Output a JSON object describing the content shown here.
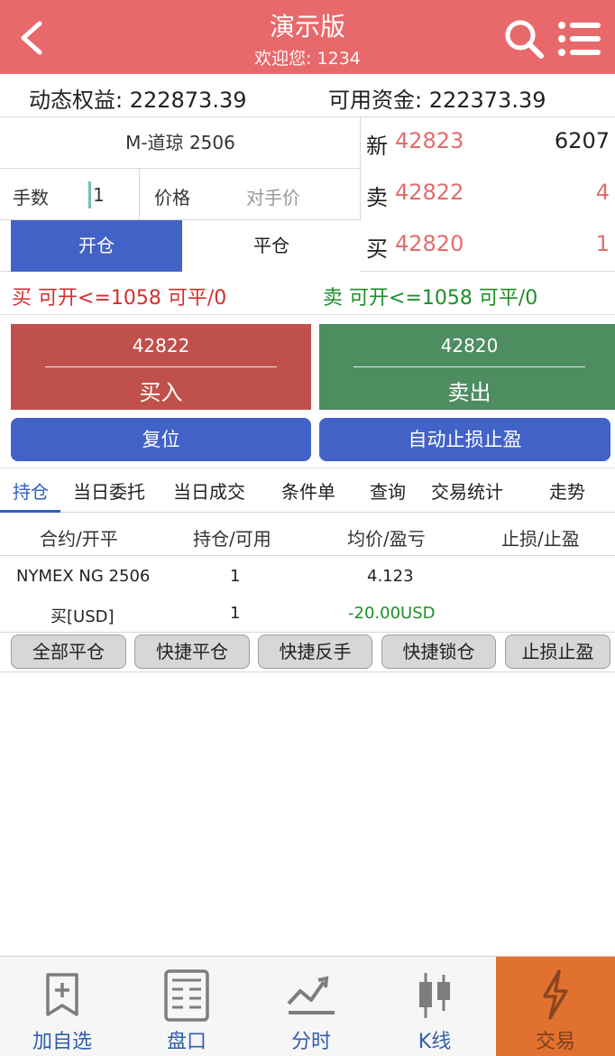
{
  "header": {
    "title": "演示版",
    "subtitle": "欢迎您: 1234",
    "color": "#e8696b",
    "icons": [
      "back-arrow-icon",
      "search-icon",
      "menu-list-icon"
    ]
  },
  "account": {
    "dynamic_equity": "动态权益: 222873.39",
    "available_funds": "可用资金: 222373.39"
  },
  "order": {
    "contract": "M-道琼 2506",
    "qty_label": "手数",
    "qty_value": "1",
    "price_label": "价格",
    "price_value": "对手价",
    "open_label": "开仓",
    "close_label": "平仓"
  },
  "quotes": [
    {
      "label": "新",
      "price": "42823",
      "volume": "6207",
      "volume_color": "#222222"
    },
    {
      "label": "卖",
      "price": "42822",
      "volume": "4",
      "volume_color": "#e36b6b"
    },
    {
      "label": "买",
      "price": "42820",
      "volume": "1",
      "volume_color": "#e36b6b"
    }
  ],
  "limits": {
    "buy": "买 可开<=1058 可平/0",
    "sell": "卖  可开<=1058 可平/0"
  },
  "trade_buttons": {
    "buy_price": "42822",
    "buy_label": "买入",
    "sell_price": "42820",
    "sell_label": "卖出"
  },
  "actions": {
    "reset": "复位",
    "auto_stop": "自动止损止盈"
  },
  "tabs": [
    "持仓",
    "当日委托",
    "当日成交",
    "条件单",
    "查询",
    "交易统计",
    "走势"
  ],
  "active_tab": "持仓",
  "positions": {
    "columns": [
      "合约/开平",
      "持仓/可用",
      "均价/盈亏",
      "止损/止盈"
    ],
    "rows": [
      {
        "contract": "NYMEX NG 2506",
        "side": "买[USD]",
        "position": "1",
        "available": "1",
        "avg_price": "4.123",
        "pnl": "-20.00USD"
      }
    ]
  },
  "quick_buttons": [
    "全部平仓",
    "快捷平仓",
    "快捷反手",
    "快捷锁仓",
    "止损止盈"
  ],
  "nav": {
    "items": [
      {
        "label": "加自选",
        "icon": "bookmark-add-icon"
      },
      {
        "label": "盘口",
        "icon": "order-book-icon"
      },
      {
        "label": "分时",
        "icon": "timeshare-chart-icon"
      },
      {
        "label": "K线",
        "icon": "candlestick-icon"
      },
      {
        "label": "交易",
        "icon": "lightning-icon"
      }
    ],
    "active": "交易",
    "active_color": "#e1712f"
  },
  "colors": {
    "accent_blue": "#4262c7",
    "buy_red": "#c0504b",
    "sell_green": "#4d8d60",
    "price_red": "#e36b6b"
  }
}
